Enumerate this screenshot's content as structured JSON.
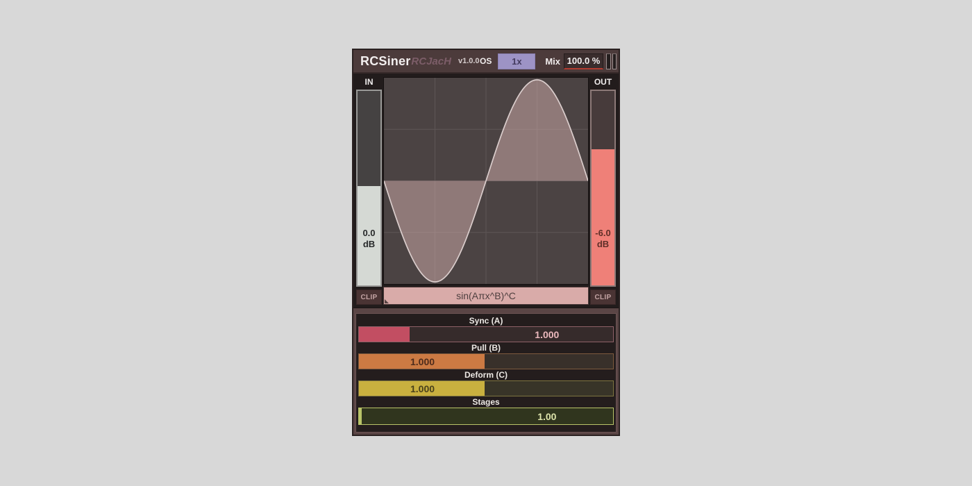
{
  "window": {
    "title_brand": "RCSiner",
    "title_author": "RCJacH",
    "version": "v1.0.0",
    "os_label": "OS",
    "os_value": "1x",
    "mix_label": "Mix",
    "mix_value": "100.0 %",
    "titlebar_bars_icon": "vertical-bars"
  },
  "meters": {
    "input": {
      "label": "IN",
      "db_value": "0.0",
      "db_unit": "dB",
      "clip_label": "CLIP",
      "fill_pct": 51
    },
    "output": {
      "label": "OUT",
      "db_value": "-6.0",
      "db_unit": "dB",
      "clip_label": "CLIP",
      "fill_pct": 70
    }
  },
  "waveform": {
    "formula": "sin(Aπx^B)^C",
    "type": "sine",
    "x_min": -1,
    "x_max": 1,
    "a": 1,
    "b": 1,
    "c": 1,
    "amplitude_fraction": 0.98,
    "grid_divisions": 4
  },
  "sliders": [
    {
      "label": "Sync (A)",
      "value": "1.000",
      "fill_pct": 20,
      "text_pos_pct": 74
    },
    {
      "label": "Pull (B)",
      "value": "1.000",
      "fill_pct": 49.5,
      "text_pos_pct": 25
    },
    {
      "label": "Deform (C)",
      "value": "1.000",
      "fill_pct": 49.5,
      "text_pos_pct": 25
    },
    {
      "label": "Stages",
      "value": "1.00",
      "fill_pct": 1.2,
      "text_pos_pct": 74
    }
  ],
  "colors": {
    "page_bg": "#d8d8d8",
    "frame": "#5a4545",
    "titlebar_bg": "#4c3b3b",
    "panel_bg": "#221c1c",
    "os_button": "#9d93c5",
    "mix_underline": "#b23c31",
    "meter_in_fill": "#d5d9d4",
    "meter_out_fill": "#ef8078",
    "wave_bg": "#4b4343",
    "wave_stroke": "#dbcecd",
    "formula_bg": "#d9aba9",
    "accent_sync": "#c24e62",
    "accent_pull": "#cc7a43",
    "accent_deform": "#c9b03f",
    "accent_stages": "#b9c469"
  }
}
